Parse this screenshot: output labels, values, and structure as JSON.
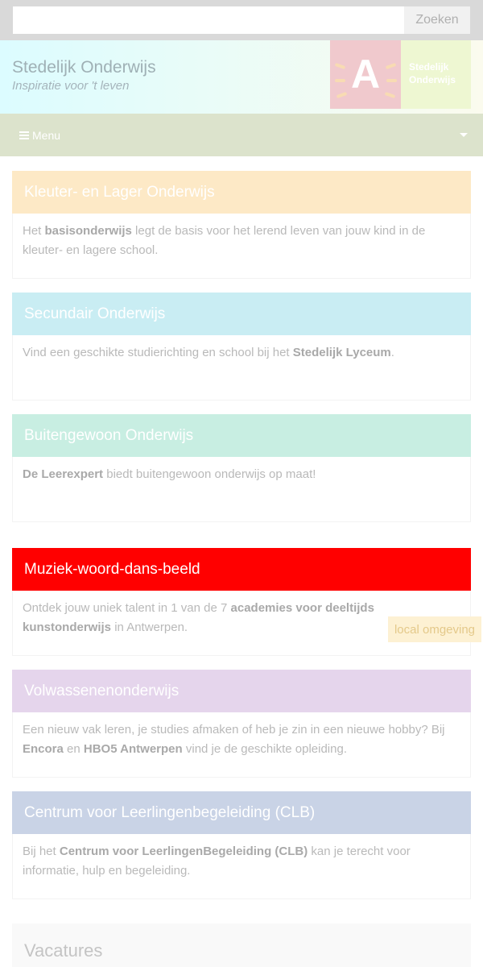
{
  "search": {
    "placeholder": "",
    "button_label": "Zoeken"
  },
  "header": {
    "title": "Stedelijk Onderwijs",
    "tagline": "Inspiratie voor 't leven",
    "logo_letter": "A",
    "logo_text_line1": "Stedelijk",
    "logo_text_line2": "Onderwijs"
  },
  "menu": {
    "label": "Menu"
  },
  "cards": [
    {
      "title": "Kleuter- en Lager Onderwijs",
      "color": "#fde9c6",
      "body": [
        {
          "t": "Het "
        },
        {
          "b": "basisonderwijs"
        },
        {
          "t": " legt de basis voor het lerend leven van jouw kind in de kleuter- en lagere school."
        }
      ]
    },
    {
      "title": "Secundair Onderwijs",
      "color": "#c9edf3",
      "body": [
        {
          "t": "Vind een geschikte studierichting en school bij het "
        },
        {
          "b": "Stedelijk Lyceum"
        },
        {
          "t": "."
        }
      ]
    },
    {
      "title": "Buitengewoon Onderwijs",
      "color": "#c8eee2",
      "body": [
        {
          "b": "De Leerexpert"
        },
        {
          "t": " biedt buitengewoon onderwijs op maat!"
        }
      ]
    },
    {
      "title": "Muziek-woord-dans-beeld",
      "color": "#ff0000",
      "body": [
        {
          "t": "Ontdek jouw uniek talent in 1 van de 7 "
        },
        {
          "b": "academies voor deeltijds kunstonderwijs"
        },
        {
          "t": " in Antwerpen."
        }
      ]
    },
    {
      "title": "Volwassenenonderwijs",
      "color": "#e5d5ec",
      "body": [
        {
          "t": "Een nieuw vak leren, je studies afmaken of heb je zin in een nieuwe hobby? Bij "
        },
        {
          "b": "Encora"
        },
        {
          "t": " en "
        },
        {
          "b": "HBO5 Antwerpen"
        },
        {
          "t": " vind je de geschikte opleiding."
        }
      ]
    },
    {
      "title": "Centrum voor Leerlingenbegeleiding (CLB)",
      "color": "#c9d3e6",
      "body": [
        {
          "t": "Bij het "
        },
        {
          "b": "Centrum voor LeerlingenBegeleiding (CLB)"
        },
        {
          "t": " kan je terecht voor informatie, hulp en begeleiding."
        }
      ]
    }
  ],
  "local_badge": "local omgeving",
  "vacatures": {
    "title": "Vacatures"
  }
}
